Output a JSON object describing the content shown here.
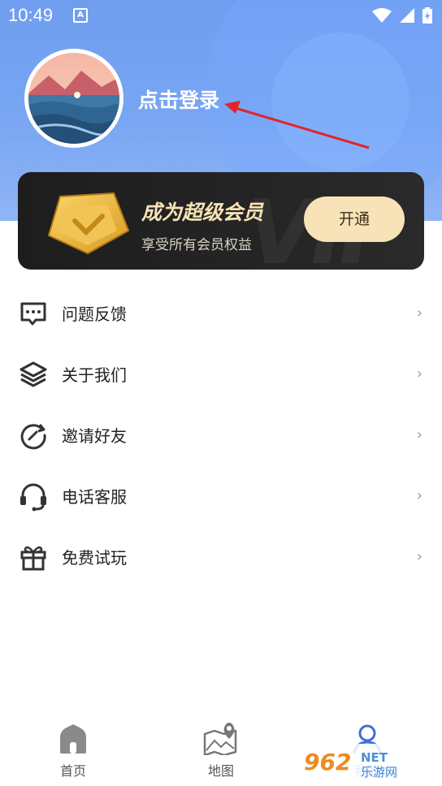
{
  "status_bar": {
    "time": "10:49",
    "notification": "A"
  },
  "profile": {
    "login_text": "点击登录"
  },
  "vip": {
    "watermark": "VIP",
    "title": "成为超级会员",
    "subtitle": "享受所有会员权益",
    "button": "开通"
  },
  "menu": {
    "items": [
      {
        "label": "问题反馈",
        "icon": "feedback-icon",
        "chevron": "›"
      },
      {
        "label": "关于我们",
        "icon": "layers-icon",
        "chevron": "›"
      },
      {
        "label": "邀请好友",
        "icon": "refresh-icon",
        "chevron": "›"
      },
      {
        "label": "电话客服",
        "icon": "headset-icon",
        "chevron": "›"
      },
      {
        "label": "免费试玩",
        "icon": "gift-icon",
        "chevron": "›"
      }
    ]
  },
  "bottom_nav": {
    "home": "首页",
    "map": "地图",
    "me": "我的"
  },
  "watermark": {
    "brand": "962",
    "net": "NET",
    "site": "乐游网"
  },
  "colors": {
    "header": "#79a6f3",
    "vip_gold": "#f7e3b7",
    "active": "#3d6fd8"
  }
}
